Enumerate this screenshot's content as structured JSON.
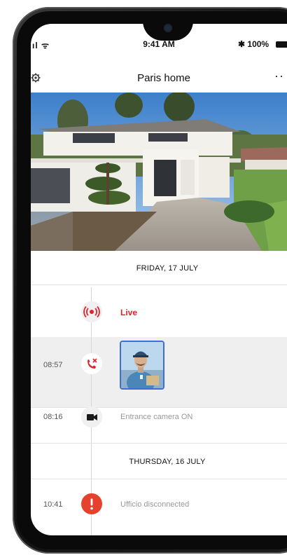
{
  "status_bar": {
    "signal": "ıl ᯤ",
    "time": "9:41 AM",
    "battery": "✱ 100%"
  },
  "header": {
    "title": "Paris home",
    "settings_icon": "gear-icon",
    "more_icon": "more-icon"
  },
  "sections": [
    {
      "date": "FRIDAY, 17 JULY"
    },
    {
      "date": "THURSDAY, 16 JULY"
    }
  ],
  "events": {
    "live": {
      "label": "Live",
      "icon": "live-broadcast-icon"
    },
    "missed_call": {
      "time": "08:57",
      "icon": "missed-call-icon"
    },
    "camera_on": {
      "time": "08:16",
      "text": "Entrance camera ON",
      "icon": "video-camera-icon"
    },
    "disconnected": {
      "time": "10:41",
      "text": "Ufficio disconnected",
      "icon": "alert-icon"
    }
  },
  "colors": {
    "accent_red": "#e0242d",
    "highlight_row": "#efefef",
    "thumb_border": "#3a6fd8"
  }
}
